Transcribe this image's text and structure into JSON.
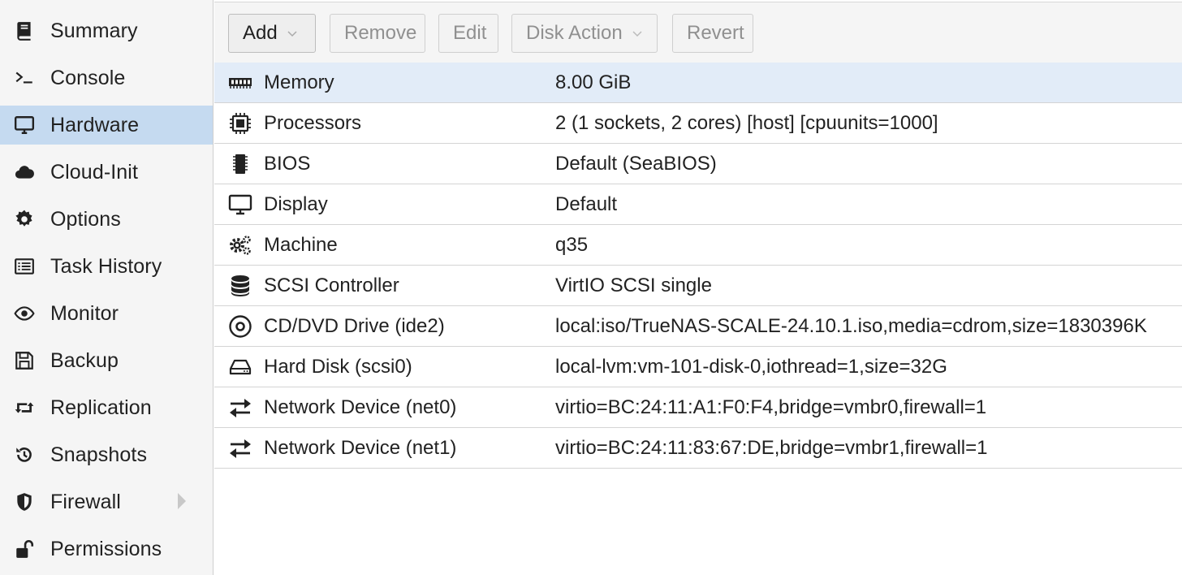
{
  "sidebar": {
    "items": [
      {
        "label": "Summary",
        "icon": "book-icon"
      },
      {
        "label": "Console",
        "icon": "terminal-icon"
      },
      {
        "label": "Hardware",
        "icon": "desktop-icon",
        "active": true
      },
      {
        "label": "Cloud-Init",
        "icon": "cloud-icon"
      },
      {
        "label": "Options",
        "icon": "gear-icon"
      },
      {
        "label": "Task History",
        "icon": "list-icon"
      },
      {
        "label": "Monitor",
        "icon": "eye-icon"
      },
      {
        "label": "Backup",
        "icon": "floppy-icon"
      },
      {
        "label": "Replication",
        "icon": "retweet-icon"
      },
      {
        "label": "Snapshots",
        "icon": "history-icon"
      },
      {
        "label": "Firewall",
        "icon": "shield-icon",
        "expandable": true
      },
      {
        "label": "Permissions",
        "icon": "unlock-icon"
      }
    ]
  },
  "toolbar": {
    "add_label": "Add",
    "remove_label": "Remove",
    "edit_label": "Edit",
    "disk_action_label": "Disk Action",
    "revert_label": "Revert"
  },
  "hardware": {
    "rows": [
      {
        "name": "Memory",
        "value": "8.00 GiB",
        "icon": "memory-icon",
        "selected": true
      },
      {
        "name": "Processors",
        "value": "2 (1 sockets, 2 cores) [host] [cpuunits=1000]",
        "icon": "cpu-icon"
      },
      {
        "name": "BIOS",
        "value": "Default (SeaBIOS)",
        "icon": "chip-icon"
      },
      {
        "name": "Display",
        "value": "Default",
        "icon": "desktop-icon"
      },
      {
        "name": "Machine",
        "value": "q35",
        "icon": "gears-icon"
      },
      {
        "name": "SCSI Controller",
        "value": "VirtIO SCSI single",
        "icon": "database-icon"
      },
      {
        "name": "CD/DVD Drive (ide2)",
        "value": "local:iso/TrueNAS-SCALE-24.10.1.iso,media=cdrom,size=1830396K",
        "icon": "cdrom-icon"
      },
      {
        "name": "Hard Disk (scsi0)",
        "value": "local-lvm:vm-101-disk-0,iothread=1,size=32G",
        "icon": "hdd-icon"
      },
      {
        "name": "Network Device (net0)",
        "value": "virtio=BC:24:11:A1:F0:F4,bridge=vmbr0,firewall=1",
        "icon": "exchange-icon"
      },
      {
        "name": "Network Device (net1)",
        "value": "virtio=BC:24:11:83:67:DE,bridge=vmbr1,firewall=1",
        "icon": "exchange-icon"
      }
    ]
  },
  "colors": {
    "selected_nav": "#c5daf0",
    "selected_row": "#e2ecf8"
  }
}
